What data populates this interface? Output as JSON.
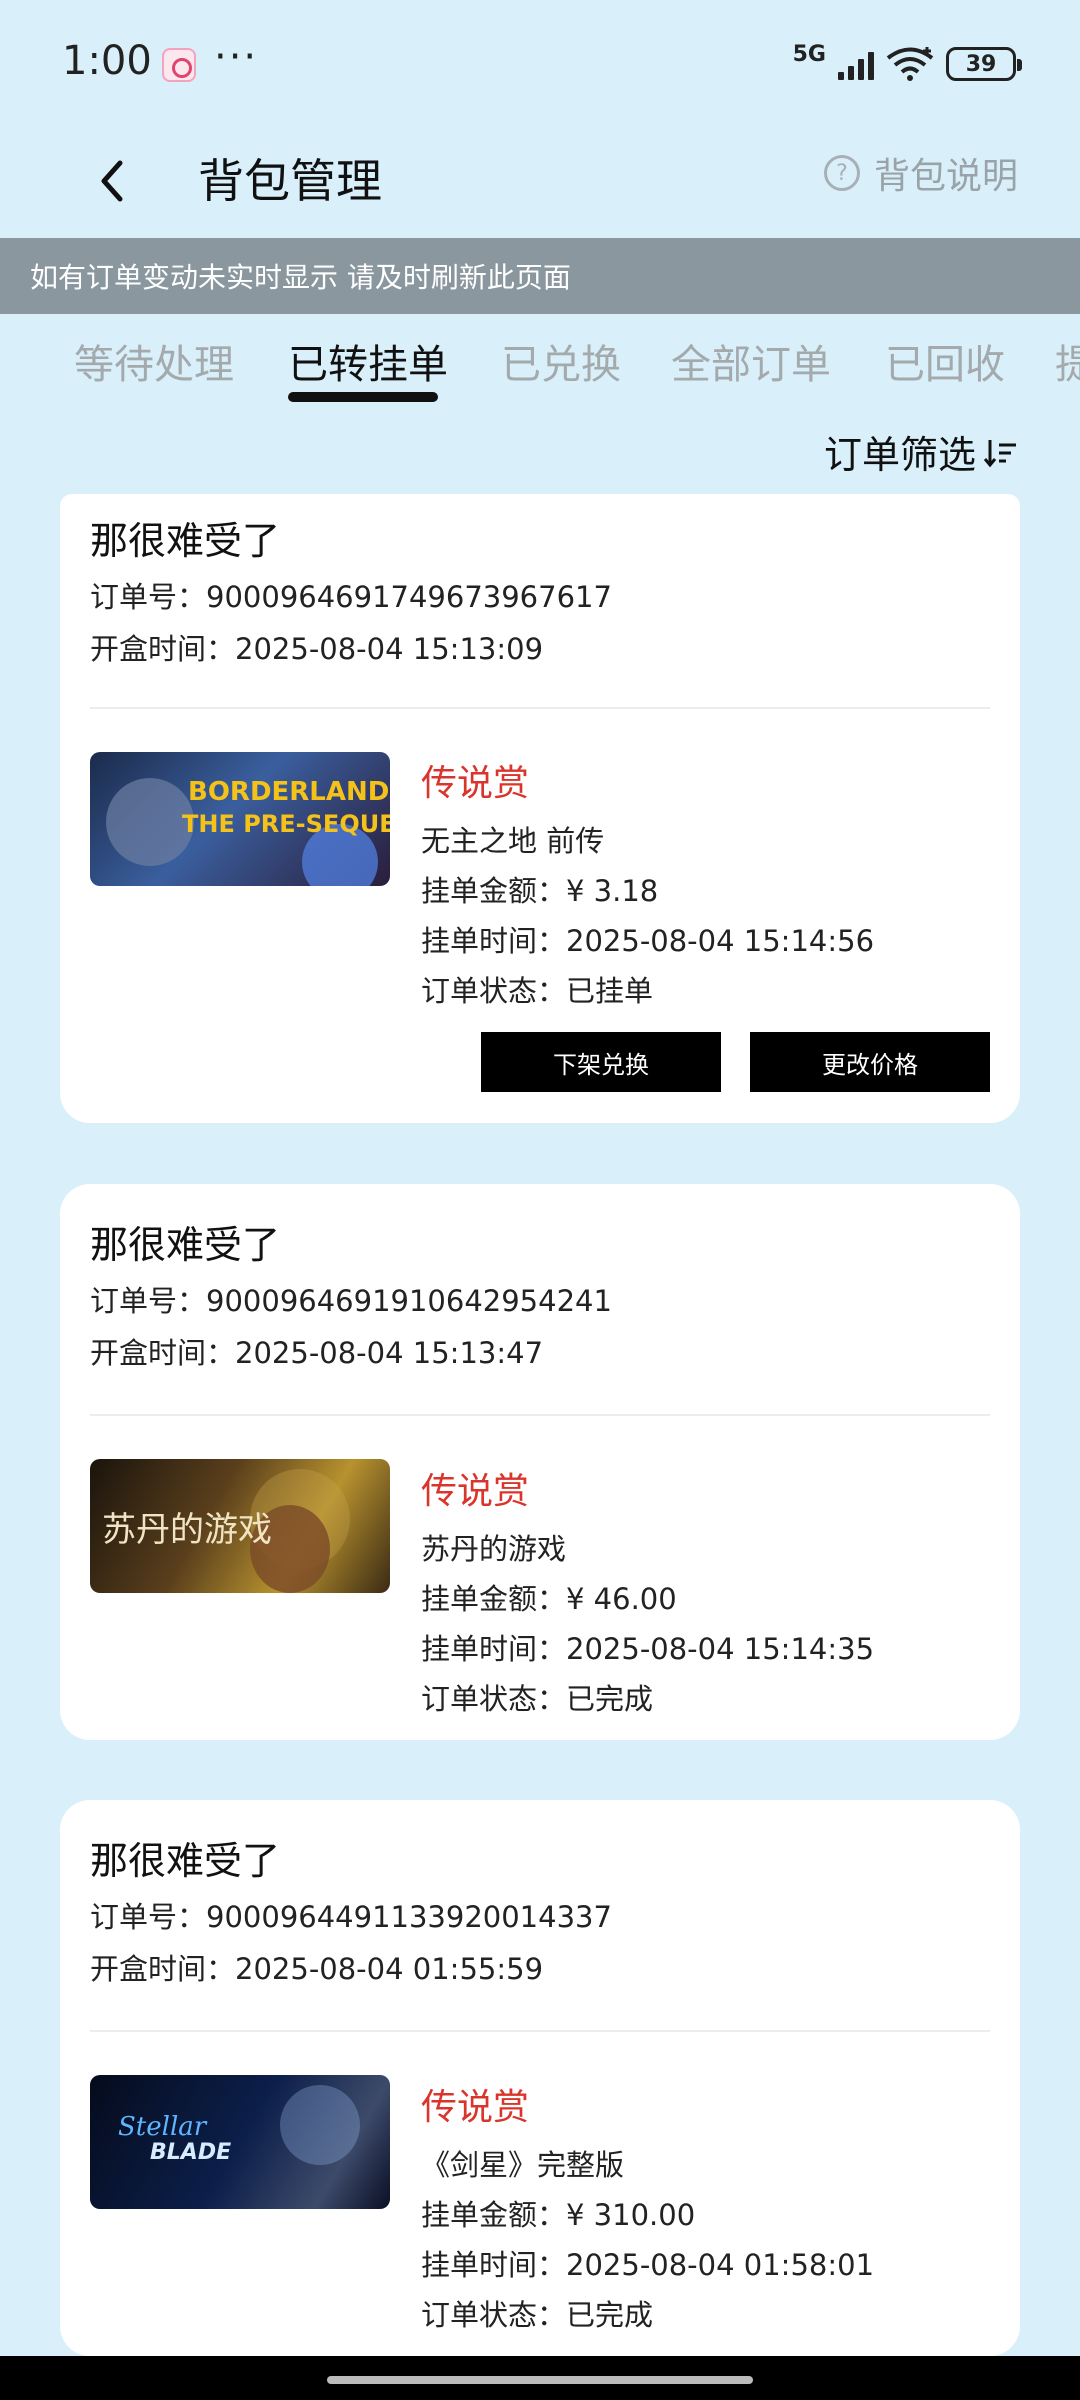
{
  "status_bar": {
    "time": "1:00",
    "dots": "···",
    "network": "5G",
    "battery": "39"
  },
  "header": {
    "title": "背包管理",
    "help_label": "背包说明",
    "help_glyph": "?"
  },
  "notice": "如有订单变动未实时显示 请及时刷新此页面",
  "tabs": [
    {
      "label": "等待处理",
      "active": false
    },
    {
      "label": "已转挂单",
      "active": true
    },
    {
      "label": "已兑换",
      "active": false
    },
    {
      "label": "全部订单",
      "active": false
    },
    {
      "label": "已回收",
      "active": false
    },
    {
      "label": "提",
      "active": false
    }
  ],
  "filter": {
    "label": "订单筛选"
  },
  "orders": [
    {
      "user": "那很难受了",
      "order_no_label": "订单号：",
      "order_no": "9000964691749673967617",
      "open_time_label": "开盒时间：",
      "open_time": "2025-08-04 15:13:09",
      "prize_tier": "传说赏",
      "game": "无主之地 前传",
      "price_label": "挂单金额：",
      "price": "¥ 3.18",
      "list_time_label": "挂单时间：",
      "list_time": "2025-08-04 15:14:56",
      "status_label": "订单状态：",
      "status": "已挂单",
      "thumb_text_1": "BORDERLANDS",
      "thumb_text_2": "THE PRE-SEQUEL!",
      "buttons": {
        "unlist": "下架兑换",
        "change_price": "更改价格"
      }
    },
    {
      "user": "那很难受了",
      "order_no_label": "订单号：",
      "order_no": "9000964691910642954241",
      "open_time_label": "开盒时间：",
      "open_time": "2025-08-04 15:13:47",
      "prize_tier": "传说赏",
      "game": "苏丹的游戏",
      "price_label": "挂单金额：",
      "price": "¥ 46.00",
      "list_time_label": "挂单时间：",
      "list_time": "2025-08-04 15:14:35",
      "status_label": "订单状态：",
      "status": "已完成",
      "thumb_text_1": "苏丹的游戏"
    },
    {
      "user": "那很难受了",
      "order_no_label": "订单号：",
      "order_no": "9000964491133920014337",
      "open_time_label": "开盒时间：",
      "open_time": "2025-08-04 01:55:59",
      "prize_tier": "传说赏",
      "game": "《剑星》完整版",
      "price_label": "挂单金额：",
      "price": "¥ 310.00",
      "list_time_label": "挂单时间：",
      "list_time": "2025-08-04 01:58:01",
      "status_label": "订单状态：",
      "status": "已完成",
      "thumb_text_1": "Stellar",
      "thumb_text_2": "BLADE"
    }
  ]
}
